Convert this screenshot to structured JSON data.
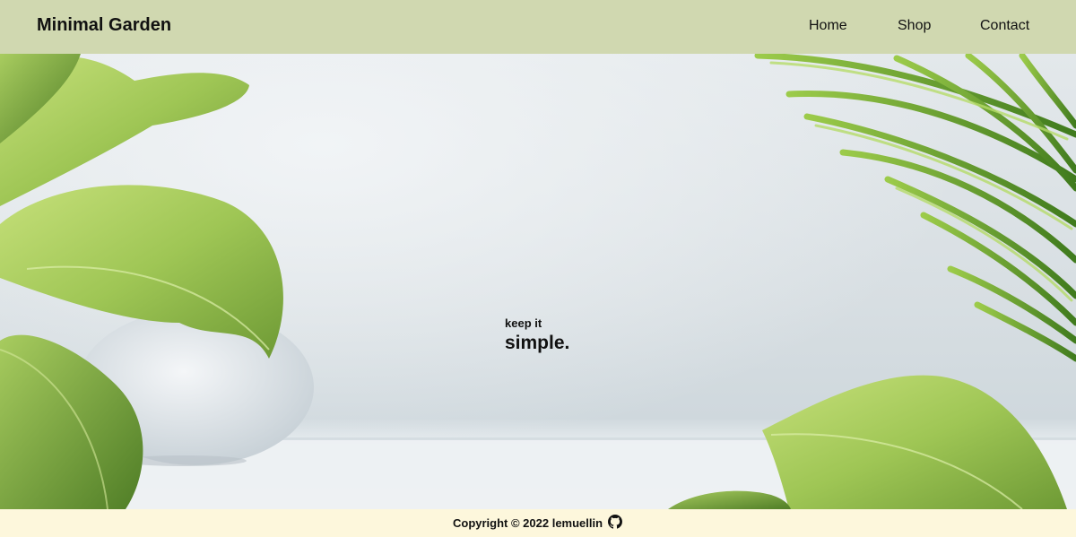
{
  "header": {
    "brand": "Minimal Garden",
    "nav": [
      {
        "label": "Home"
      },
      {
        "label": "Shop"
      },
      {
        "label": "Contact"
      }
    ],
    "background_color": "#d0d8b0"
  },
  "hero": {
    "tagline_small": "keep it",
    "tagline_large": "simple.",
    "image": "minimal plants on light wall background"
  },
  "footer": {
    "copyright": "Copyright © 2022 lemuellin",
    "icon": "github-icon",
    "background_color": "#fdf7dc"
  }
}
